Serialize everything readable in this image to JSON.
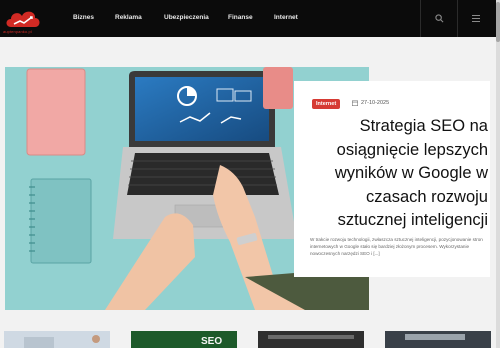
{
  "header": {
    "logo_text": "auptenpanko.pl",
    "nav": [
      {
        "label": "Biznes"
      },
      {
        "label": "Reklama"
      },
      {
        "label": "Ubezpieczenia"
      },
      {
        "label": "Finanse"
      },
      {
        "label": "Internet"
      }
    ],
    "search_icon": "search-icon",
    "menu_icon": "hamburger-menu-icon"
  },
  "hero": {
    "category": "Internet",
    "date": "27-10-2025",
    "title": "Strategia SEO na osiągnięcie lepszych wyników w Google w czasach rozwoju sztucznej inteligencji",
    "excerpt": "W trakcie rozwoju technologii, zwłaszcza sztucznej inteligencji, pozycjonowanie stron internetowych w Google stało się bardziej złożonym procesem. Wykorzystanie nowoczesnych narzędzi SEO i [...]"
  },
  "thumbnails": [
    {
      "label": ""
    },
    {
      "label": "SEO"
    },
    {
      "label": ""
    },
    {
      "label": ""
    }
  ],
  "colors": {
    "accent": "#d63a33",
    "header_bg": "#0b0b0b",
    "page_bg": "#f2f2f2"
  }
}
